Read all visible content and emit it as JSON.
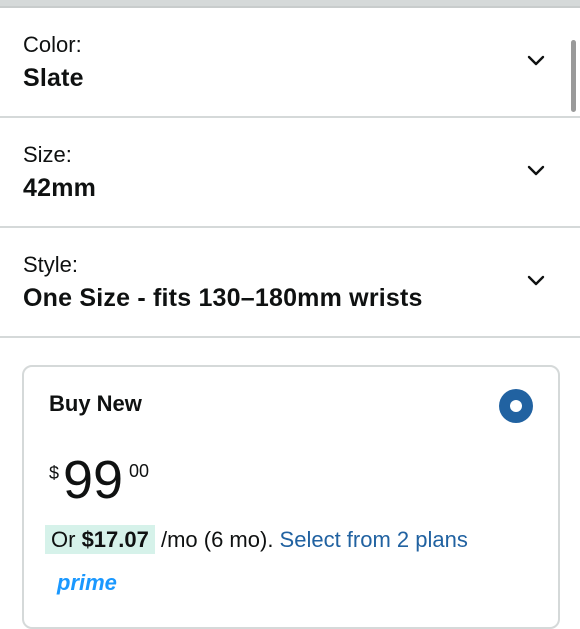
{
  "variants": [
    {
      "label": "Color:",
      "value": "Slate"
    },
    {
      "label": "Size:",
      "value": "42mm"
    },
    {
      "label": "Style:",
      "value": "One Size - fits 130–180mm wrists"
    }
  ],
  "buy_box": {
    "title": "Buy New",
    "price": {
      "symbol": "$",
      "whole": "99",
      "fraction": "00"
    },
    "installment": {
      "prefix": "Or ",
      "amount": "$17.07",
      "suffix": " /mo (6 mo). ",
      "link": "Select from 2 plans"
    },
    "prime_label": "prime"
  },
  "colors": {
    "link": "#2162a1",
    "radio": "#2162a1",
    "installment_highlight": "#d6f2ea",
    "divider": "#d5d9d9",
    "prime": "#1a98ff"
  },
  "icons": {
    "dropdown": "chevron-down-icon",
    "selected": "radio-selected-icon"
  }
}
